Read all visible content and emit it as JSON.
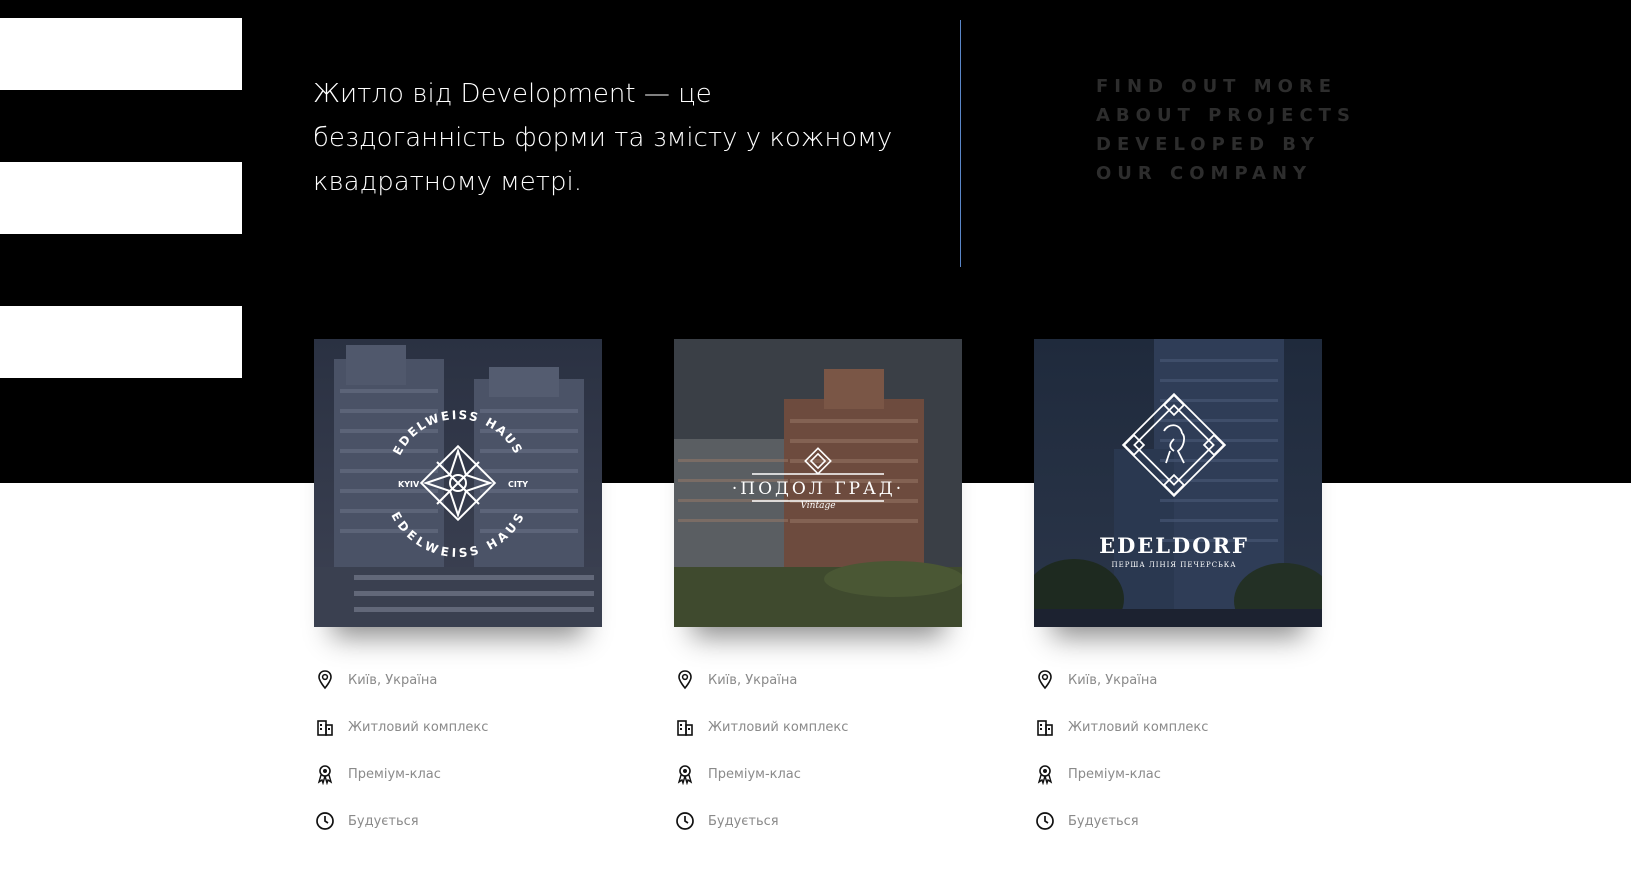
{
  "intro": {
    "text": "Житло від Development — це бездоганність форми та змісту у кожному квадратному метрі."
  },
  "cta": {
    "label": "Find out more about projects developed by our company"
  },
  "colors": {
    "band": "#000000",
    "accent_line": "#5a86c8",
    "fact_text": "#8a8a8a",
    "cta_text": "#2d2d2d"
  },
  "projects": [
    {
      "logo_text": "EDELWEISS HAUS",
      "logo_left": "KYIV",
      "logo_right": "CITY",
      "facts": [
        {
          "icon": "map-pin-icon",
          "label": "Київ, Україна"
        },
        {
          "icon": "building-icon",
          "label": "Житловий комплекс"
        },
        {
          "icon": "award-icon",
          "label": "Преміум-клас"
        },
        {
          "icon": "clock-icon",
          "label": "Будується"
        }
      ]
    },
    {
      "logo_text": "·ПОДОЛ ГРАД·",
      "logo_sub": "Vintage",
      "facts": [
        {
          "icon": "map-pin-icon",
          "label": "Київ, Україна"
        },
        {
          "icon": "building-icon",
          "label": "Житловий комплекс"
        },
        {
          "icon": "award-icon",
          "label": "Преміум-клас"
        },
        {
          "icon": "clock-icon",
          "label": "Будується"
        }
      ]
    },
    {
      "logo_text": "EDELDORF",
      "logo_sub": "ПЕРША ЛІНІЯ ПЕЧЕРСЬКА",
      "facts": [
        {
          "icon": "map-pin-icon",
          "label": "Київ, Україна"
        },
        {
          "icon": "building-icon",
          "label": "Житловий комплекс"
        },
        {
          "icon": "award-icon",
          "label": "Преміум-клас"
        },
        {
          "icon": "clock-icon",
          "label": "Будується"
        }
      ]
    }
  ]
}
